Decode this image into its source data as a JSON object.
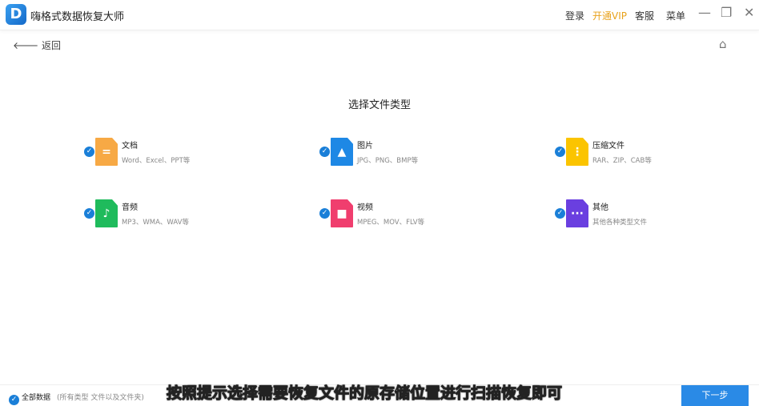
{
  "app": {
    "title": "嗨格式数据恢复大师",
    "logo": "D"
  },
  "topbar": {
    "login": "登录",
    "vip": "开通VIP",
    "service": "客服",
    "menu": "菜单"
  },
  "nav": {
    "back": "返回"
  },
  "main": {
    "heading": "选择文件类型",
    "types": [
      {
        "name": "文档",
        "desc": "Word、Excel、PPT等",
        "color": "#f7a945",
        "glyph": "="
      },
      {
        "name": "图片",
        "desc": "JPG、PNG、BMP等",
        "color": "#1e88e5",
        "glyph": "▲"
      },
      {
        "name": "压缩文件",
        "desc": "RAR、ZIP、CAB等",
        "color": "#fbc400",
        "glyph": "⋮"
      },
      {
        "name": "音频",
        "desc": "MP3、WMA、WAV等",
        "color": "#1fbb5c",
        "glyph": "♪"
      },
      {
        "name": "视频",
        "desc": "MPEG、MOV、FLV等",
        "color": "#f03e6e",
        "glyph": "■"
      },
      {
        "name": "其他",
        "desc": "其他各种类型文件",
        "color": "#6a3fe0",
        "glyph": "···"
      }
    ]
  },
  "footer": {
    "all_label": "全部数据",
    "all_note": "(所有类型 文件以及文件夹)",
    "next": "下一步"
  },
  "caption": "按照提示选择需要恢复文件的原存储位置进行扫描恢复即可"
}
